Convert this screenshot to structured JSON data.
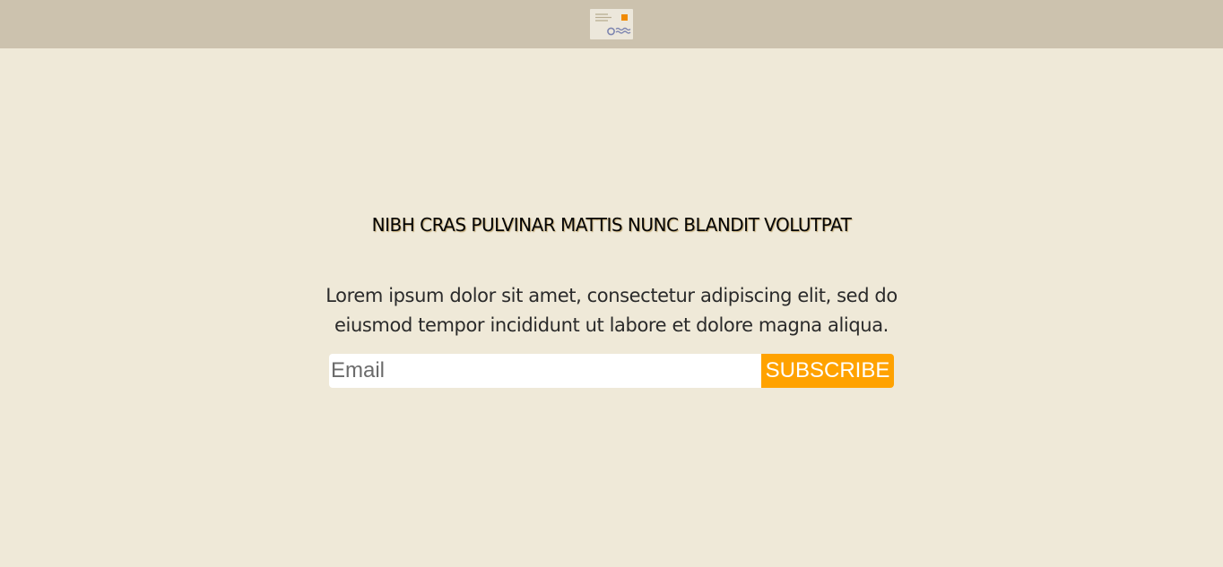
{
  "header": {
    "logo_icon": "postcard-envelope-icon",
    "background_color": "#ccc2ae"
  },
  "hero": {
    "title": "NIBH CRAS PULVINAR MATTIS NUNC BLANDIT VOLUTPAT",
    "description": "Lorem ipsum dolor sit amet, consectetur adipiscing elit, sed do eiusmod tempor incididunt ut labore et dolore magna aliqua."
  },
  "signup": {
    "email_placeholder": "Email",
    "email_value": "",
    "button_label": "SUBSCRIBE",
    "button_color": "#ffa200"
  },
  "page": {
    "background_color": "#efe9d8"
  }
}
